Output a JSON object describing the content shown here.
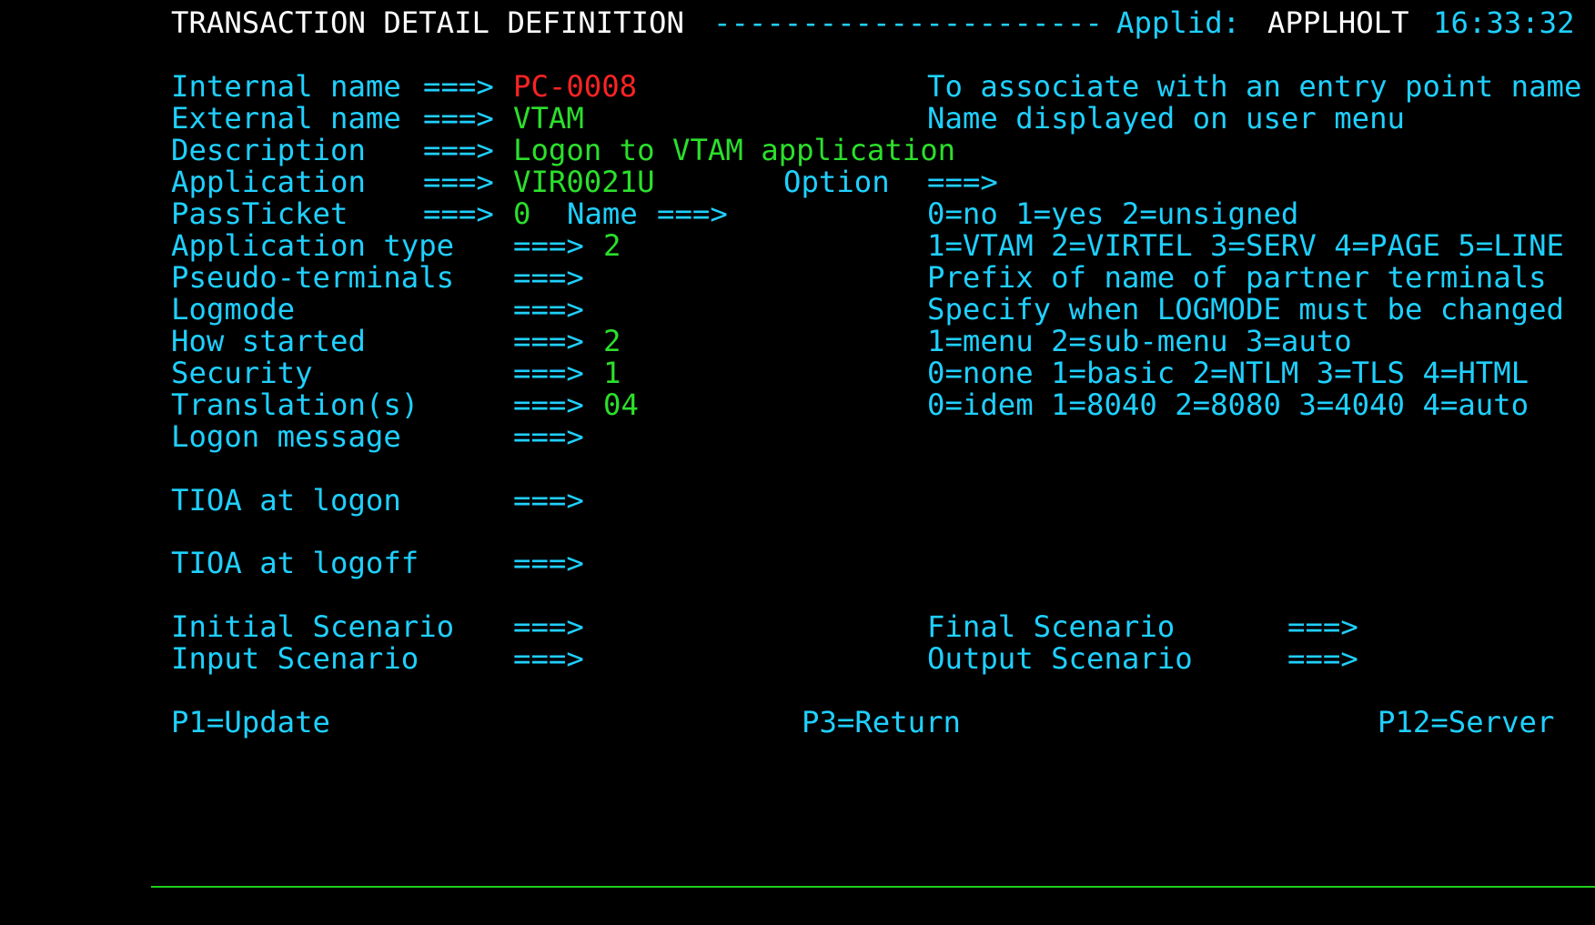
{
  "header": {
    "title": "TRANSACTION DETAIL DEFINITION",
    "dashes": "----------------------",
    "applid_label": "Applid:",
    "applid_value": "APPLHOLT",
    "time": "16:33:32"
  },
  "fields": {
    "internal_name": {
      "label": "Internal name",
      "arrow": "===>",
      "value": "PC-0008",
      "help": "To associate with an entry point name"
    },
    "external_name": {
      "label": "External name",
      "arrow": "===>",
      "value": "VTAM",
      "help": "Name displayed on user menu"
    },
    "description": {
      "label": "Description",
      "arrow": "===>",
      "value": "Logon to VTAM application"
    },
    "application": {
      "label": "Application",
      "arrow": "===>",
      "value": "VIR0021U",
      "option_label": "Option",
      "option_arrow": "===>",
      "option_value": ""
    },
    "passticket": {
      "label": "PassTicket",
      "arrow": "===>",
      "value": "0",
      "name_label": "Name",
      "name_arrow": "===>",
      "name_value": "",
      "help": "0=no 1=yes 2=unsigned"
    },
    "application_type": {
      "label": "Application type",
      "arrow": "===>",
      "value": "2",
      "help": "1=VTAM 2=VIRTEL 3=SERV 4=PAGE 5=LINE"
    },
    "pseudo_terminals": {
      "label": "Pseudo-terminals",
      "arrow": "===>",
      "value": "",
      "help": "Prefix of name of partner terminals"
    },
    "logmode": {
      "label": "Logmode",
      "arrow": "===>",
      "value": "",
      "help": "Specify when LOGMODE must be changed"
    },
    "how_started": {
      "label": "How started",
      "arrow": "===>",
      "value": "2",
      "help": "1=menu 2=sub-menu 3=auto"
    },
    "security": {
      "label": "Security",
      "arrow": "===>",
      "value": "1",
      "help": "0=none 1=basic 2=NTLM 3=TLS 4=HTML"
    },
    "translations": {
      "label": "Translation(s)",
      "arrow": "===>",
      "value": "04",
      "help": "0=idem 1=8040 2=8080 3=4040 4=auto"
    },
    "logon_message": {
      "label": "Logon message",
      "arrow": "===>",
      "value": ""
    },
    "tioa_logon": {
      "label": "TIOA at logon",
      "arrow": "===>",
      "value": ""
    },
    "tioa_logoff": {
      "label": "TIOA at logoff",
      "arrow": "===>",
      "value": ""
    },
    "initial_scenario": {
      "label": "Initial Scenario",
      "arrow": "===>",
      "value": ""
    },
    "final_scenario": {
      "label": "Final Scenario",
      "arrow": "===>",
      "value": ""
    },
    "input_scenario": {
      "label": "Input Scenario",
      "arrow": "===>",
      "value": ""
    },
    "output_scenario": {
      "label": "Output Scenario",
      "arrow": "===>",
      "value": ""
    }
  },
  "pfkeys": {
    "p1": "P1=Update",
    "p3": "P3=Return",
    "p12": "P12=Server"
  },
  "colors": {
    "background": "#000000",
    "label": "#1fd0ff",
    "input": "#2be02b",
    "key_field": "#ff2323",
    "header": "#ffffff"
  }
}
